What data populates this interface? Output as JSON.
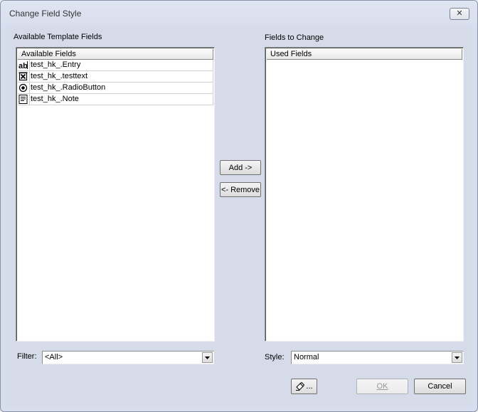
{
  "window": {
    "title": "Change Field Style",
    "close_label": "✕"
  },
  "available": {
    "group_label": "Available Template Fields",
    "column_header": "Available Fields",
    "items": [
      {
        "label": "test_hk_.Entry",
        "icon": "text-entry-icon"
      },
      {
        "label": "test_hk_.testtext",
        "icon": "checkbox-icon"
      },
      {
        "label": "test_hk_.RadioButton",
        "icon": "radio-button-icon"
      },
      {
        "label": "test_hk_.Note",
        "icon": "note-icon"
      }
    ]
  },
  "used": {
    "group_label": "Fields to Change",
    "column_header": "Used Fields"
  },
  "buttons": {
    "add": "Add ->",
    "remove": "<- Remove",
    "ok": "OK",
    "cancel": "Cancel",
    "edit_style": "..."
  },
  "filter": {
    "label": "Filter:",
    "value": "<All>"
  },
  "style": {
    "label": "Style:",
    "value": "Normal"
  }
}
